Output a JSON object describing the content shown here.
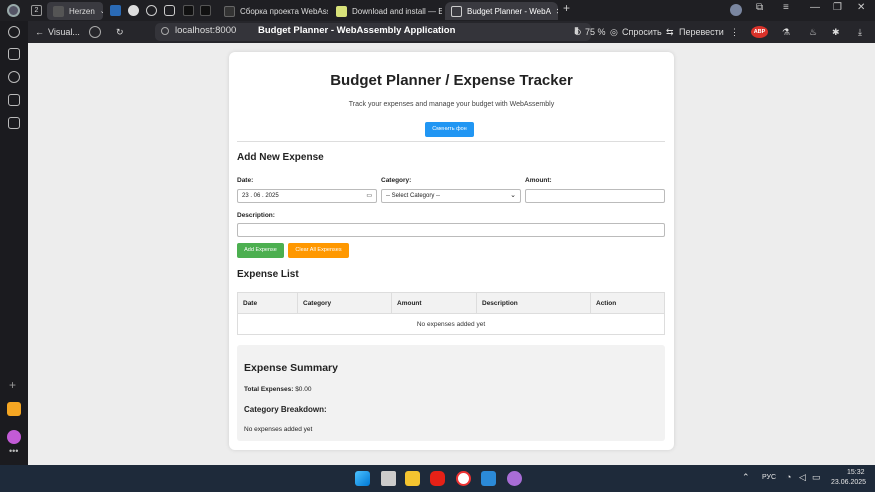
{
  "browser": {
    "tab_count": "2",
    "tabs": [
      {
        "label": "Herzen"
      },
      {
        "label": "Сборка проекта WebAss"
      },
      {
        "label": "Download and install — Em"
      },
      {
        "label": "Budget Planner - WebA"
      }
    ],
    "back_label": "Visual...",
    "url": "localhost:8000",
    "page_title": "Budget Planner - WebAssembly Application",
    "zoom": "75 %",
    "ask_label": "Спросить",
    "translate_label": "Перевести",
    "adblock_badge": "ABP"
  },
  "app": {
    "title": "Budget Planner / Expense Tracker",
    "subtitle": "Track your expenses and manage your budget with WebAssembly",
    "bg_button": "Сменить фон",
    "add_heading": "Add New Expense",
    "date_label": "Date:",
    "date_value": "23 . 06 . 2025",
    "category_label": "Category:",
    "category_value": "-- Select Category --",
    "amount_label": "Amount:",
    "description_label": "Description:",
    "add_button": "Add Expense",
    "clear_button": "Clear All Expenses",
    "list_heading": "Expense List",
    "columns": [
      "Date",
      "Category",
      "Amount",
      "Description",
      "Action"
    ],
    "empty_message": "No expenses added yet",
    "summary_heading": "Expense Summary",
    "total_label": "Total Expenses:",
    "total_value": "$0.00",
    "breakdown_heading": "Category Breakdown:",
    "breakdown_empty": "No expenses added yet"
  },
  "taskbar": {
    "lang": "РУС",
    "time": "15:32",
    "date": "23.06.2025"
  },
  "colors": {
    "blue_button": "#2196f3",
    "green_button": "#4caf50",
    "orange_button": "#ff9800"
  }
}
